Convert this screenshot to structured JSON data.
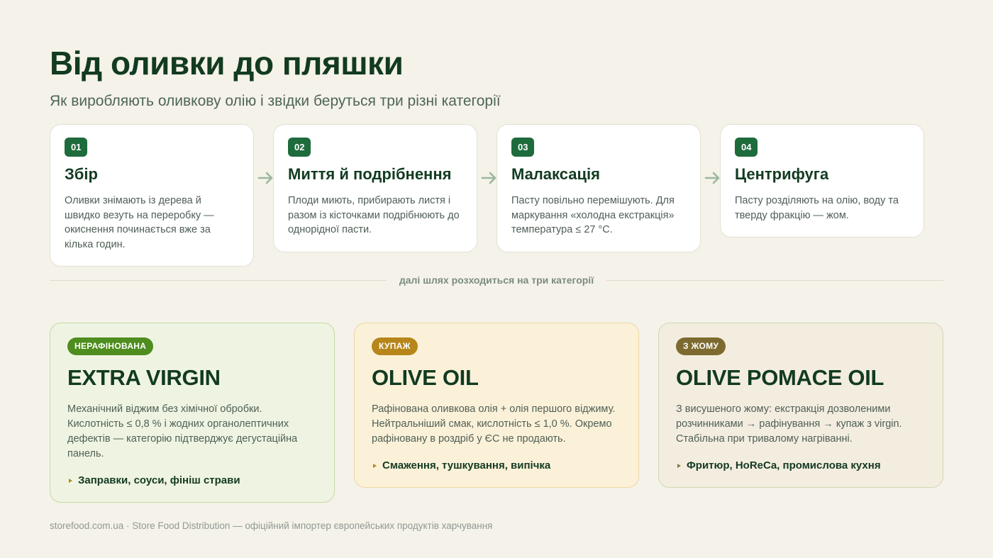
{
  "header": {
    "title": "Від оливки до пляшки",
    "subtitle": "Як виробляють оливкову олію і звідки беруться три різні категорії"
  },
  "steps": [
    {
      "num": "01",
      "title": "Збір",
      "text": "Оливки знімають із дерева й швидко везуть на переробку — окиснення починається вже за кілька годин."
    },
    {
      "num": "02",
      "title": "Миття й подрібнення",
      "text": "Плоди миють, прибирають листя і разом із кісточками подрібнюють до однорідної пасти."
    },
    {
      "num": "03",
      "title": "Малаксація",
      "text": "Пасту повільно перемішують. Для маркування «холодна екстракція» температура ≤ 27 °C."
    },
    {
      "num": "04",
      "title": "Центрифуга",
      "text": "Пасту розділяють на олію, воду та тверду фракцію — жом."
    }
  ],
  "divider": {
    "label": "далі шлях розходиться на три категорії"
  },
  "categories": [
    {
      "badge": "НЕРАФІНОВАНА",
      "title": "EXTRA VIRGIN",
      "text": "Механічний віджим без хімічної обробки. Кислотність ≤ 0,8 % і жодних органолептичних дефектів — категорію підтверджує дегустаційна панель.",
      "use": "Заправки, соуси, фініш страви"
    },
    {
      "badge": "КУПАЖ",
      "title": "OLIVE OIL",
      "text": "Рафінована оливкова олія + олія першого віджиму. Нейтральніший смак, кислотність ≤ 1,0 %. Окремо рафіновану в роздріб у ЄС не продають.",
      "use": "Смаження, тушкування, випічка"
    },
    {
      "badge": "З ЖОМУ",
      "title": "OLIVE POMACE OIL",
      "text": "З висушеного жому: екстракція дозволеними розчинниками → рафінування → купаж з virgin. Стабільна при тривалому нагріванні.",
      "use": "Фритюр, HoReCa, промислова кухня"
    }
  ],
  "footer": {
    "text": "storefood.com.ua · Store Food Distribution — офіційний імпортер європейських продуктів харчування"
  },
  "colors": {
    "accent": "#1e6b3c",
    "background": "#f5f2ea",
    "arrow": "#9bb8a0"
  },
  "icons": {
    "step_arrow": "arrow-right-icon",
    "use_bullet": "triangle-bullet-icon"
  }
}
